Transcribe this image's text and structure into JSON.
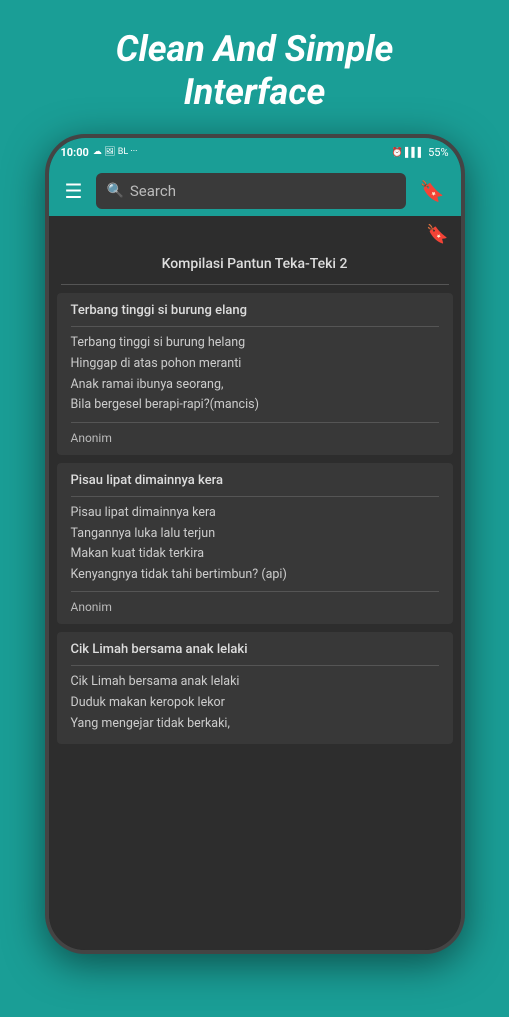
{
  "header": {
    "title_line1": "Clean And Simple",
    "title_line2": "Interface"
  },
  "statusBar": {
    "time": "10:00",
    "icons_left": "☁ 🖼 BL ···",
    "battery": "55%",
    "icons_right": "⏰ |||"
  },
  "navBar": {
    "hamburger_label": "☰",
    "search_placeholder": "Search",
    "bookmark_label": "🔖"
  },
  "bookHeader": {
    "bookmark_icon": "🔖",
    "title": "Kompilasi Pantun Teka-Teki 2"
  },
  "pantunList": [
    {
      "title": "Terbang tinggi si burung elang",
      "lines": [
        "Terbang tinggi si burung helang",
        "Hinggap di atas pohon meranti",
        "Anak ramai ibunya seorang,",
        "Bila bergesel berapi-rapi?(mancis)"
      ],
      "author": "Anonim"
    },
    {
      "title": "Pisau lipat dimainnya kera",
      "lines": [
        "Pisau lipat dimainnya kera",
        "Tangannya luka lalu terjun",
        "Makan kuat tidak terkira",
        "Kenyangnya tidak tahi bertimbun? (api)"
      ],
      "author": "Anonim"
    },
    {
      "title": "Cik Limah bersama anak lelaki",
      "lines": [
        "Cik Limah bersama anak lelaki",
        "Duduk makan keropok lekor",
        "Yang mengejar tidak berkaki,"
      ],
      "author": ""
    }
  ]
}
